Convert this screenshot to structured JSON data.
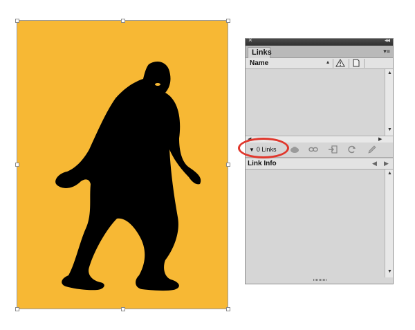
{
  "artwork": {
    "background_color": "#f7b834",
    "silhouette_color": "#000000",
    "eye_color": "#f7b834"
  },
  "panel": {
    "close_glyph": "×",
    "collapse_glyph": "◂◂",
    "tab_label": "Links",
    "menu_glyph": "▾≡",
    "column_name": "Name",
    "sort_glyph": "▴",
    "links_count": "0 Links",
    "disclosure_glyph": "▼",
    "link_info_label": "Link Info",
    "prev_glyph": "◀",
    "next_glyph": "▶",
    "toolbar_icons": [
      "cloud-icon",
      "relink-icon",
      "goto-link-icon",
      "update-link-icon",
      "edit-original-icon"
    ],
    "highlight_color": "#e0372c"
  }
}
